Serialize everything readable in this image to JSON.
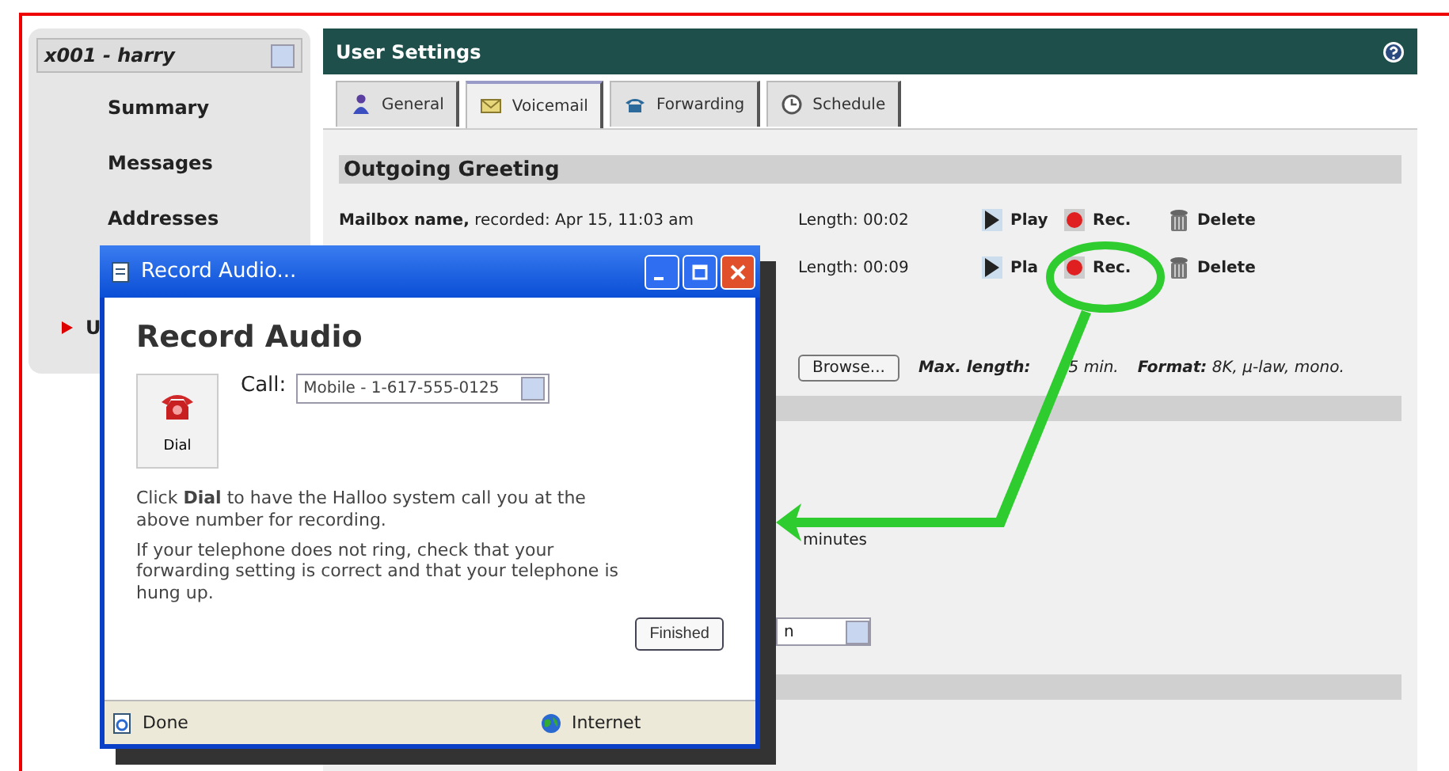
{
  "sidebar": {
    "user_select": "x001 - harry",
    "items": [
      {
        "label": "Summary",
        "selected": false
      },
      {
        "label": "Messages",
        "selected": false
      },
      {
        "label": "Addresses",
        "selected": false
      },
      {
        "label": "U",
        "selected": true
      }
    ]
  },
  "panel": {
    "title": "User Settings",
    "tabs": [
      {
        "label": "General",
        "selected": false
      },
      {
        "label": "Voicemail",
        "selected": true
      },
      {
        "label": "Forwarding",
        "selected": false
      },
      {
        "label": "Schedule",
        "selected": false
      }
    ],
    "greeting": {
      "heading": "Outgoing Greeting",
      "recordings": [
        {
          "label": "**Mailbox name,** recorded: Apr 15, 11:03 am",
          "length": "Length: 00:02",
          "play": "Play",
          "rec": "Rec.",
          "delete": "Delete"
        },
        {
          "length": "Length: 00:09",
          "play": "Pla",
          "rec": "Rec.",
          "delete": "Delete"
        }
      ],
      "upload": {
        "button": "Browse...",
        "max_label": "Max. length:",
        "max_value": "5 min.",
        "format_label": "Format:",
        "format_value": "8K, µ-law, mono."
      }
    },
    "timeout_unit": "minutes",
    "select_value": "n"
  },
  "dialog": {
    "title": "Record Audio...",
    "heading": "Record Audio",
    "dial": "Dial",
    "call_label": "Call:",
    "call_value": "Mobile - 1-617-555-0125",
    "paragraphs": [
      "Click **Dial** to have the Halloo system call you at the above number for recording.",
      "If your telephone does not ring, check that your forwarding setting is correct and that your telephone is hung up."
    ],
    "finished": "Finished",
    "status": [
      "Done",
      "Internet"
    ]
  }
}
